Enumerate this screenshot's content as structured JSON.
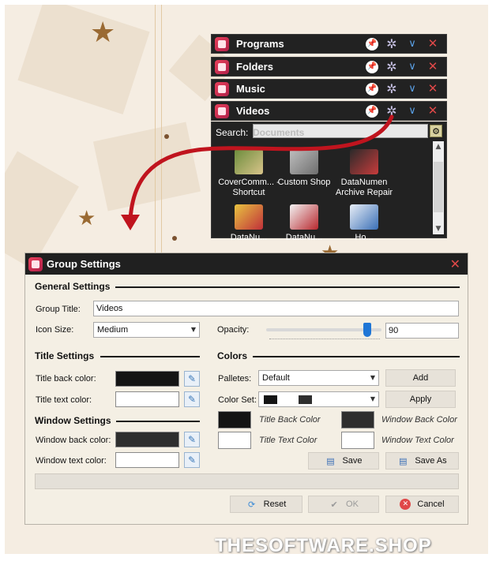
{
  "groups": [
    {
      "title": "Programs"
    },
    {
      "title": "Folders"
    },
    {
      "title": "Music"
    },
    {
      "title": "Videos"
    }
  ],
  "panel": {
    "search_label": "Search:",
    "ghost_text": "Documents",
    "items": [
      {
        "label": "CoverComm... - Shortcut",
        "icon": "cover-commander-icon"
      },
      {
        "label": "Custom Shop",
        "icon": "custom-shop-icon"
      },
      {
        "label": "DataNumen Archive Repair",
        "icon": "datanumen-archive-repair-icon"
      },
      {
        "label": "DataNu...",
        "icon": "datanumen-icon"
      },
      {
        "label": "DataNu...",
        "icon": "datanumen-tool-icon"
      },
      {
        "label": "Ho...",
        "icon": "document-icon"
      }
    ]
  },
  "dialog": {
    "title": "Group Settings",
    "general_settings": "General Settings",
    "group_title_label": "Group Title:",
    "group_title_value": "Videos",
    "icon_size_label": "Icon Size:",
    "icon_size_value": "Medium",
    "opacity_label": "Opacity:",
    "opacity_value": "90",
    "opacity_level": 0.88,
    "title_settings": "Title Settings",
    "title_back_color_label": "Title back color:",
    "title_text_color_label": "Title text color:",
    "window_settings": "Window Settings",
    "window_back_color_label": "Window back color:",
    "window_text_color_label": "Window text color:",
    "colors": "Colors",
    "palletes_label": "Palletes:",
    "palletes_value": "Default",
    "add_button": "Add",
    "color_set_label": "Color Set:",
    "apply_button": "Apply",
    "title_back_color_caption": "Title Back Color",
    "window_back_color_caption": "Window Back Color",
    "title_text_color_caption": "Title Text Color",
    "window_text_color_caption": "Window Text Color",
    "save_button": "Save",
    "save_as_button": "Save As",
    "reset_button": "Reset",
    "ok_button": "OK",
    "cancel_button": "Cancel"
  },
  "colors": {
    "title_back": "#141414",
    "title_text": "#ffffff",
    "window_back": "#2e2e2e",
    "window_text": "#ffffff",
    "arrow": "#c0141e"
  },
  "watermark": "THESOFTWARE.SHOP"
}
